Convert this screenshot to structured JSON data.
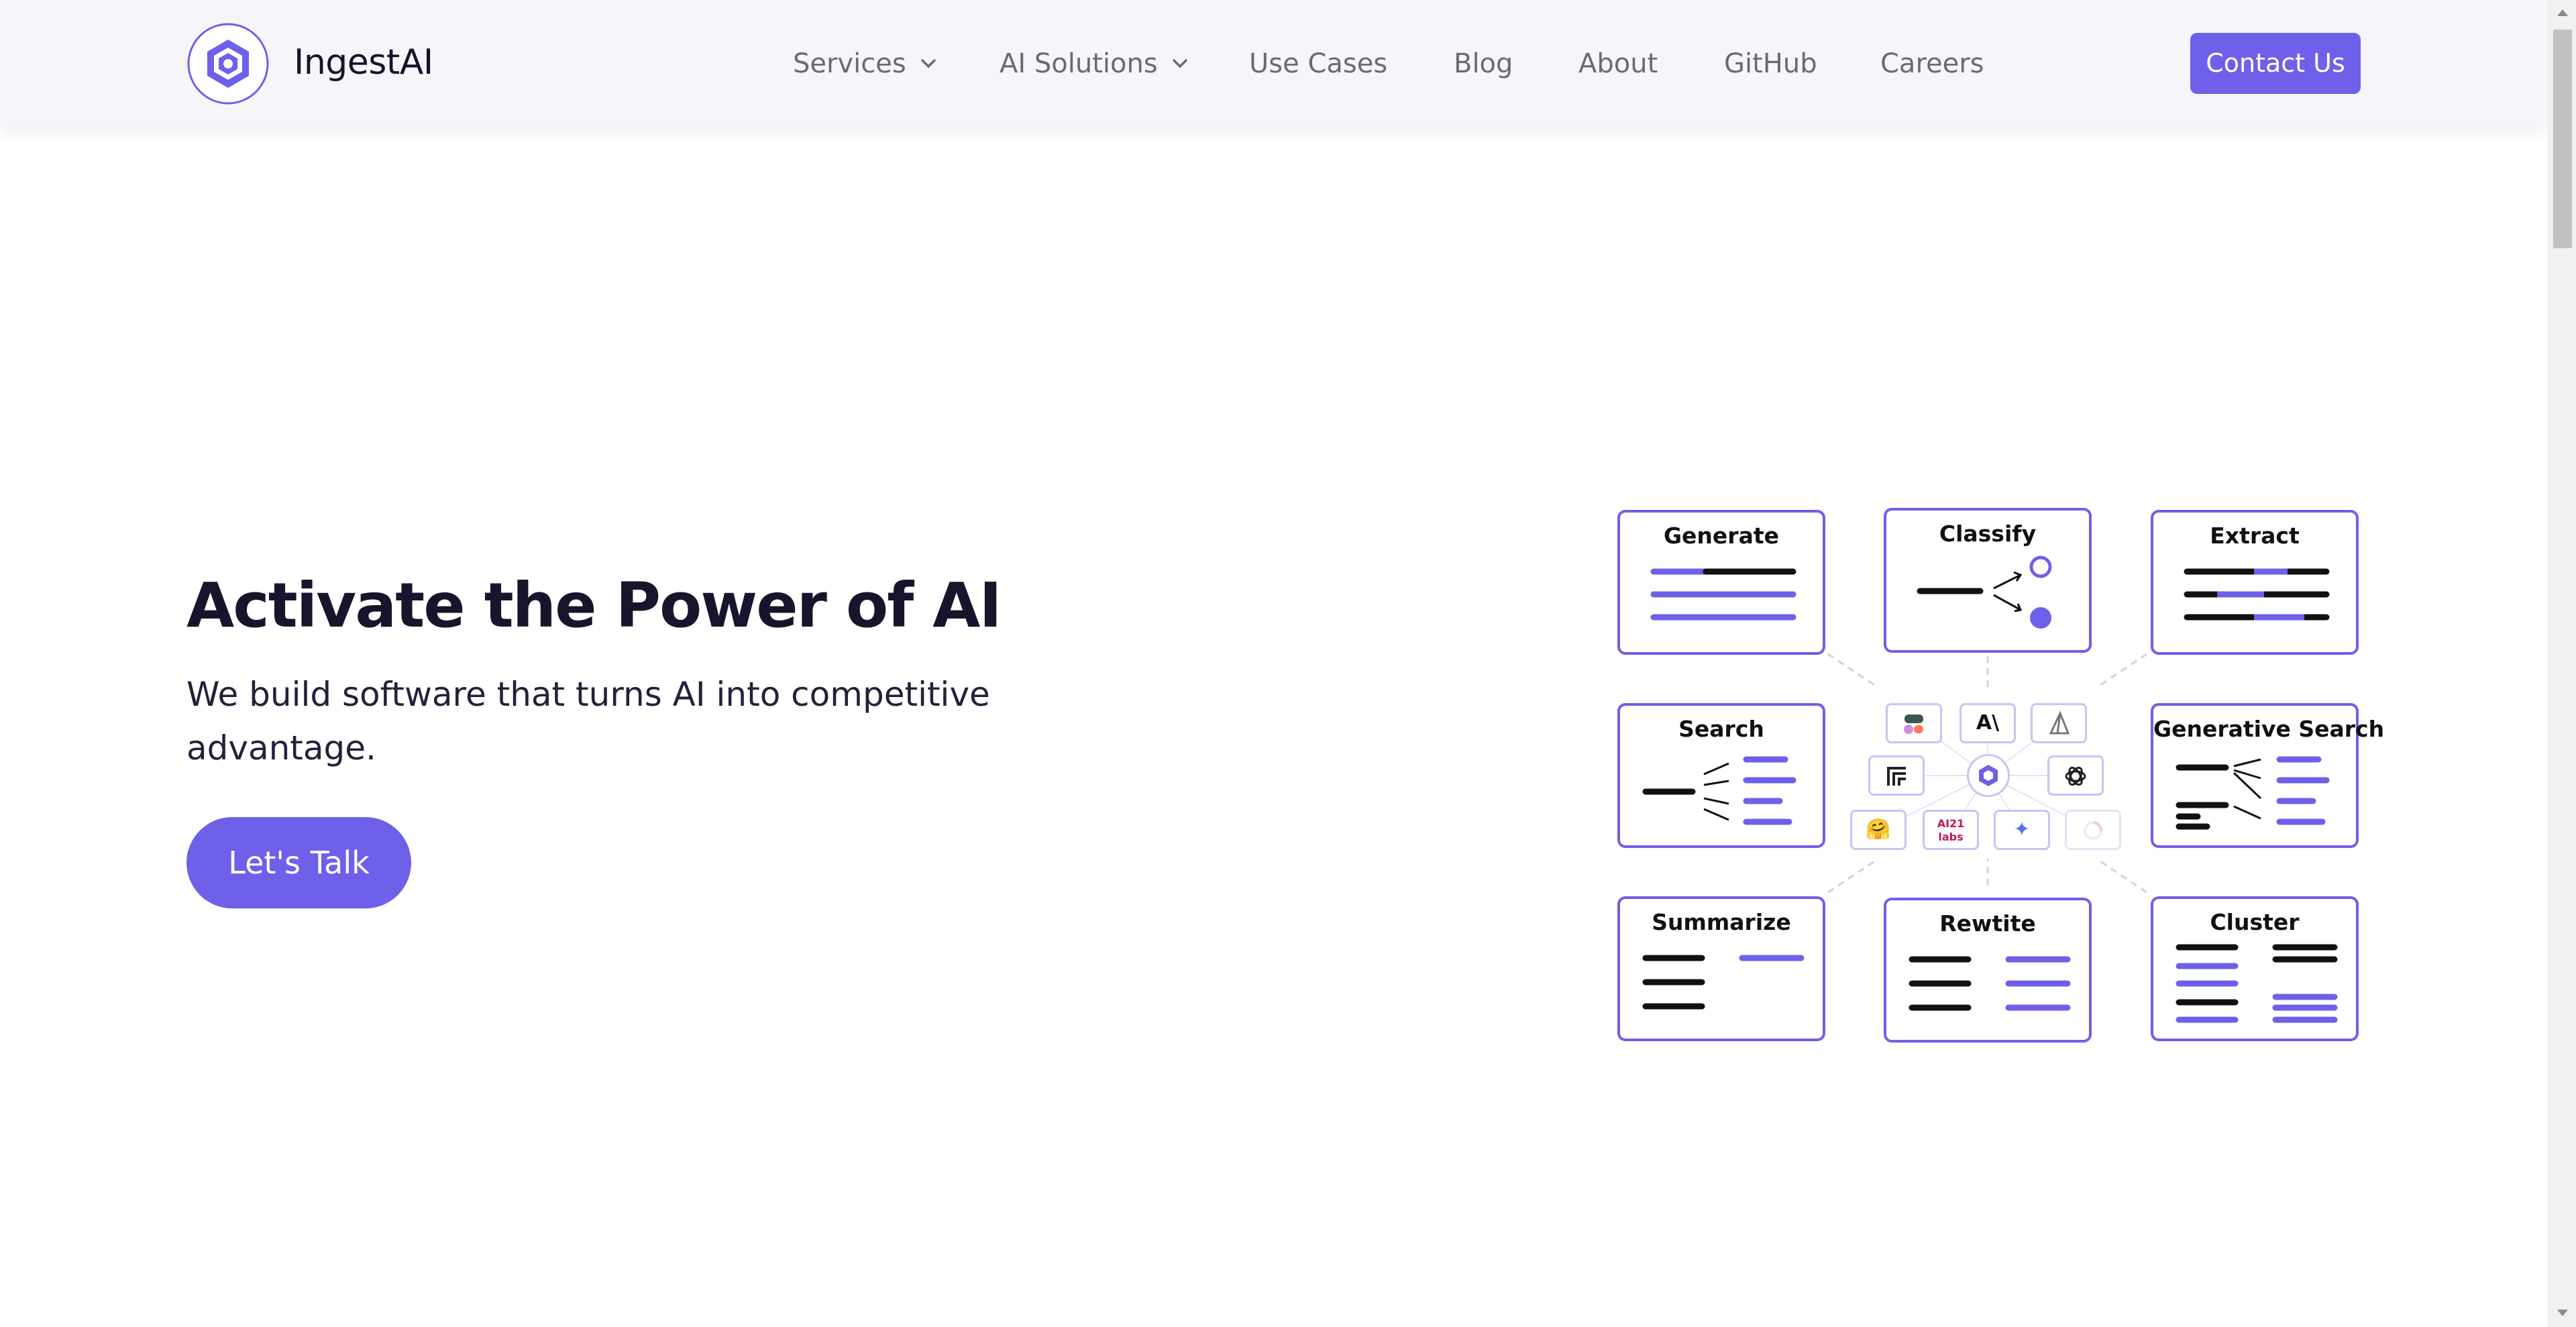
{
  "brand": {
    "name": "IngestAI",
    "logo_icon": "hexagon-logo-icon",
    "accent": "#6e60e9"
  },
  "nav": {
    "items": [
      {
        "label": "Services",
        "has_dropdown": true
      },
      {
        "label": "AI Solutions",
        "has_dropdown": true
      },
      {
        "label": "Use Cases",
        "has_dropdown": false
      },
      {
        "label": "Blog",
        "has_dropdown": false
      },
      {
        "label": "About",
        "has_dropdown": false
      },
      {
        "label": "GitHub",
        "has_dropdown": false
      },
      {
        "label": "Careers",
        "has_dropdown": false
      }
    ],
    "contact_label": "Contact Us"
  },
  "hero": {
    "title": "Activate the Power of AI",
    "subtitle": "We build software that turns AI into competitive advantage.",
    "cta_label": "Let's Talk"
  },
  "diagram": {
    "cards": {
      "generate": "Generate",
      "classify": "Classify",
      "extract": "Extract",
      "search": "Search",
      "generative_search": "Generative Search",
      "summarize": "Summarize",
      "rewrite": "Rewtite",
      "cluster": "Cluster"
    },
    "chips": [
      {
        "name": "cohere-chip",
        "icon": "cohere-logo-icon"
      },
      {
        "name": "anthropic-chip",
        "glyph": "A\\"
      },
      {
        "name": "sail-chip",
        "icon": "sail-logo-icon"
      },
      {
        "name": "stack-chip",
        "icon": "stacked-corners-icon"
      },
      {
        "name": "ingest-chip",
        "icon": "hexagon-logo-icon"
      },
      {
        "name": "openai-chip",
        "icon": "openai-logo-icon"
      },
      {
        "name": "huggingface-chip",
        "glyph": "🤗"
      },
      {
        "name": "ai21-chip",
        "glyph": "AI21 labs"
      },
      {
        "name": "gemini-chip",
        "glyph": "✦"
      },
      {
        "name": "loader-chip",
        "icon": "spinner-icon"
      }
    ]
  }
}
